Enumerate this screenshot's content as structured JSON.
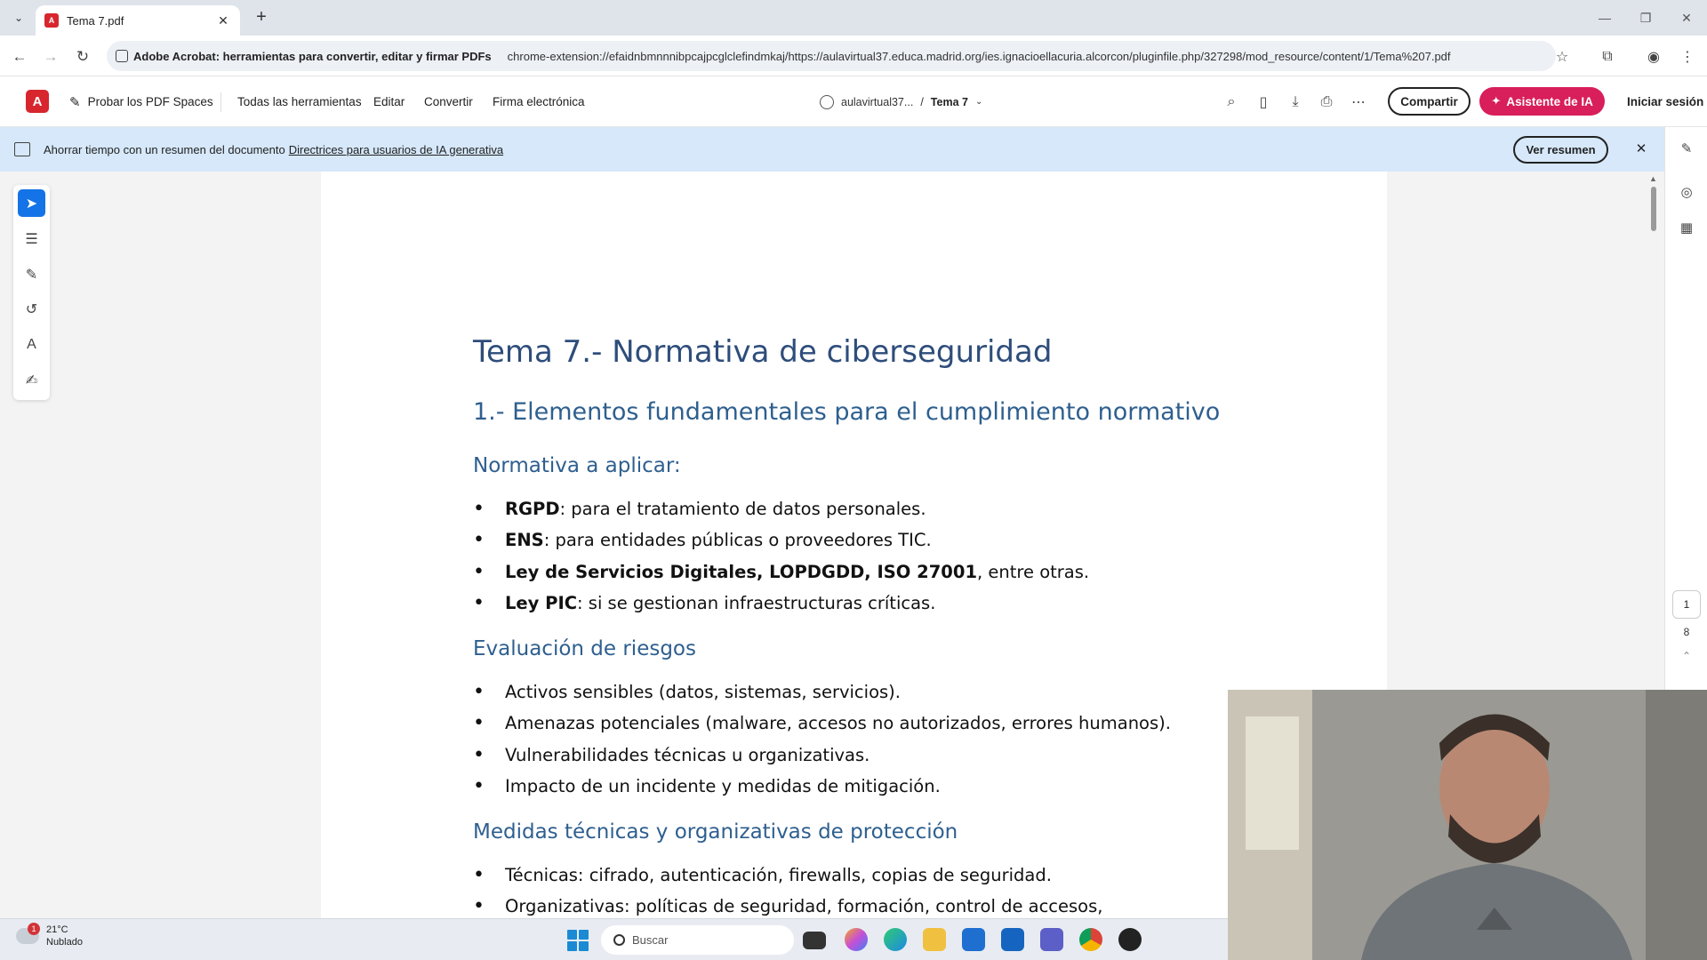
{
  "browser": {
    "tab_title": "Tema 7.pdf",
    "site_chip": "Adobe Acrobat: herramientas para convertir, editar y firmar PDFs",
    "url": "chrome-extension://efaidnbmnnnibpcajpcglclefindmkaj/https://aulavirtual37.educa.madrid.org/ies.ignacioellacuria.alcorcon/pluginfile.php/327298/mod_resource/content/1/Tema%207.pdf"
  },
  "acrobat": {
    "try_spaces": "Probar los PDF Spaces",
    "menu": [
      "Todas las herramientas",
      "Editar",
      "Convertir",
      "Firma electrónica"
    ],
    "breadcrumb_site": "aulavirtual37...",
    "breadcrumb_sep": "/",
    "breadcrumb_doc": "Tema 7",
    "share": "Compartir",
    "ai_assistant": "Asistente de IA",
    "signin": "Iniciar sesión"
  },
  "banner": {
    "text": "Ahorrar tiempo con un resumen del documento",
    "link": "Directrices para usuarios de IA generativa",
    "button": "Ver resumen"
  },
  "pager": {
    "current": "1",
    "total": "8"
  },
  "document": {
    "title": "Tema 7.- Normativa de ciberseguridad",
    "heading1": "1.- Elementos fundamentales para el cumplimiento normativo",
    "sections": [
      {
        "heading": "Normativa a aplicar:",
        "items": [
          {
            "bold": "RGPD",
            "rest": ": para el tratamiento de datos personales."
          },
          {
            "bold": "ENS",
            "rest": ": para entidades públicas o proveedores TIC."
          },
          {
            "bold": "Ley de Servicios Digitales, LOPDGDD, ISO 27001",
            "rest": ", entre otras."
          },
          {
            "bold": "Ley PIC",
            "rest": ": si se gestionan infraestructuras críticas."
          }
        ]
      },
      {
        "heading": "Evaluación de riesgos",
        "items": [
          {
            "bold": "",
            "rest": "Activos sensibles (datos, sistemas, servicios)."
          },
          {
            "bold": "",
            "rest": "Amenazas potenciales (malware, accesos no autorizados, errores humanos)."
          },
          {
            "bold": "",
            "rest": "Vulnerabilidades técnicas u organizativas."
          },
          {
            "bold": "",
            "rest": "Impacto de un incidente y medidas de mitigación."
          }
        ]
      },
      {
        "heading": "Medidas técnicas y organizativas de protección",
        "items": [
          {
            "bold": "",
            "rest": "Técnicas: cifrado, autenticación, firewalls, copias de seguridad."
          },
          {
            "bold": "",
            "rest": "Organizativas: políticas de seguridad, formación, control de accesos,"
          }
        ]
      }
    ]
  },
  "taskbar": {
    "temperature": "21°C",
    "condition": "Nublado",
    "notification_count": "1",
    "search_placeholder": "Buscar"
  },
  "colors": {
    "acrobat_red": "#d7262e",
    "ai_button": "#d81e5b",
    "banner_bg": "#d6e8fa",
    "heading_blue": "#2e5f8f",
    "active_tool": "#1473e6"
  }
}
